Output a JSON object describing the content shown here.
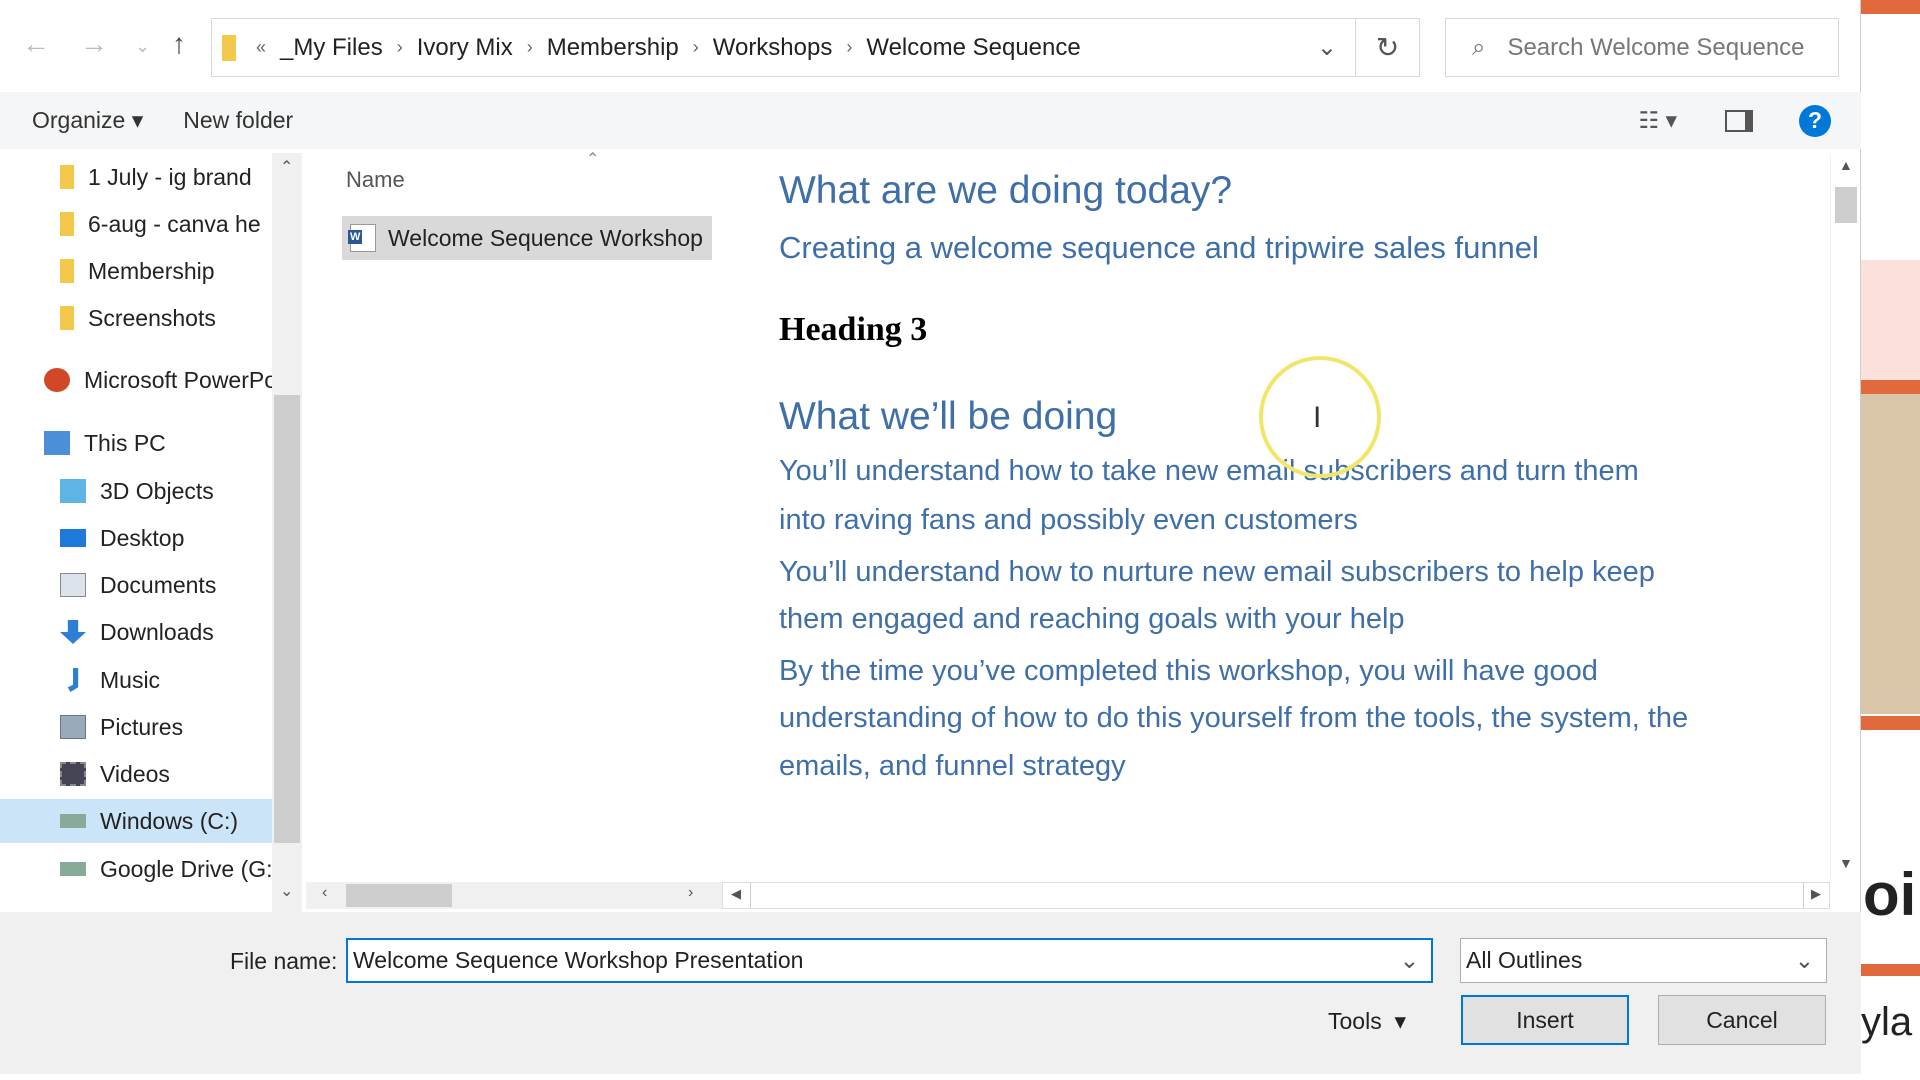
{
  "nav_buttons": {
    "back": "←",
    "forward": "→",
    "recent": "⌄",
    "up": "↑"
  },
  "breadcrumb": {
    "overflow": "«",
    "items": [
      "_My Files",
      "Ivory Mix",
      "Membership",
      "Workshops",
      "Welcome Sequence"
    ]
  },
  "search": {
    "placeholder": "Search Welcome Sequence"
  },
  "toolbar": {
    "organize": "Organize",
    "new_folder": "New folder"
  },
  "sidebar": {
    "items": [
      {
        "label": "1 July - ig brand",
        "icon": "folder-icon"
      },
      {
        "label": "6-aug - canva he",
        "icon": "folder-icon"
      },
      {
        "label": "Membership",
        "icon": "folder-icon"
      },
      {
        "label": "Screenshots",
        "icon": "folder-icon"
      },
      {
        "label": "Microsoft PowerPo",
        "icon": "powerpoint-icon"
      },
      {
        "label": "This PC",
        "icon": "pc-icon"
      },
      {
        "label": "3D Objects",
        "icon": "cube-icon"
      },
      {
        "label": "Desktop",
        "icon": "desktop-icon"
      },
      {
        "label": "Documents",
        "icon": "documents-icon"
      },
      {
        "label": "Downloads",
        "icon": "download-icon"
      },
      {
        "label": "Music",
        "icon": "music-icon"
      },
      {
        "label": "Pictures",
        "icon": "pictures-icon"
      },
      {
        "label": "Videos",
        "icon": "videos-icon"
      },
      {
        "label": "Windows (C:)",
        "icon": "drive-icon"
      },
      {
        "label": "Google Drive (G:",
        "icon": "drive-icon"
      }
    ]
  },
  "file_list": {
    "column_name": "Name",
    "files": [
      {
        "name": "Welcome Sequence Workshop",
        "icon": "word-doc-icon",
        "selected": true
      }
    ]
  },
  "preview": {
    "title": "What are we doing today?",
    "subtitle": "Creating a welcome sequence and tripwire sales funnel",
    "heading3": "Heading 3",
    "section_title": "What we’ll be doing",
    "lines": [
      "You’ll understand how to take new email subscribers and turn them",
      "into raving fans and possibly even customers",
      "You’ll understand how to nurture new email subscribers to help keep",
      "them engaged and reaching goals with your help",
      "By the time you’ve completed this workshop, you will have good",
      "understanding of how to do this yourself from the tools, the system, the",
      "emails, and funnel strategy"
    ]
  },
  "footer": {
    "file_name_label": "File name:",
    "file_name_value": "Welcome Sequence Workshop Presentation",
    "filter": "All Outlines",
    "tools": "Tools",
    "insert": "Insert",
    "cancel": "Cancel"
  },
  "background_app": {
    "text1": "oi",
    "text2": "yla"
  },
  "colors": {
    "accent": "#0078d7",
    "preview_text": "#3f6fa8",
    "orange": "#e06a3b"
  }
}
